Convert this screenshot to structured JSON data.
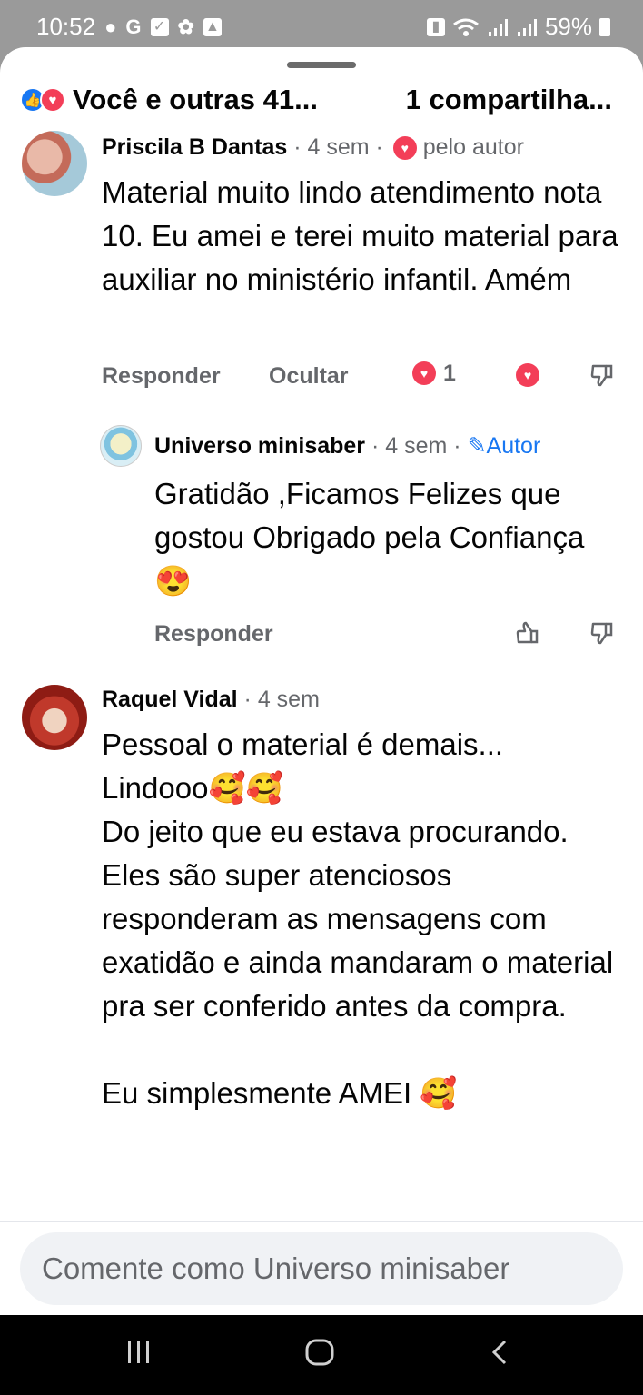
{
  "status_bar": {
    "time": "10:52",
    "left_icons": [
      "chat-icon",
      "google-icon",
      "checkbox-icon",
      "flower-icon",
      "gallery-icon"
    ],
    "right_icons": [
      "battery-saver-icon",
      "wifi-icon",
      "signal-icon",
      "signal-icon"
    ],
    "battery": "59%"
  },
  "reactions": {
    "summary": "Você e outras 41...",
    "shares": "1 compartilha..."
  },
  "comments": [
    {
      "name": "Priscila B Dantas",
      "time": "· 4 sem ·",
      "liked_by_author": "pelo autor",
      "text": "Material muito lindo atendimento nota 10. Eu amei e terei muito material para auxiliar no ministério infantil.  Amém",
      "reply_label": "Responder",
      "hide_label": "Ocultar",
      "reaction_count": "1"
    },
    {
      "name": "Universo minisaber",
      "time": "· 4 sem ·",
      "author_label": "Autor",
      "text": "Gratidão ,Ficamos Felizes que gostou Obrigado pela Confiança 😍",
      "reply_label": "Responder"
    },
    {
      "name": "Raquel Vidal",
      "time": "· 4 sem",
      "text_lines": [
        "Pessoal o material é demais...",
        "Lindooo🥰🥰",
        "Do jeito que eu estava procurando.",
        "Eles são super atenciosos responderam as mensagens com exatidão e ainda mandaram o material pra ser conferido antes da compra.",
        "",
        "Eu simplesmente AMEI 🥰"
      ]
    }
  ],
  "composer": {
    "placeholder": "Comente como Universo minisaber"
  },
  "colors": {
    "accent": "#1877f2",
    "love": "#f33e58",
    "muted": "#65676b"
  }
}
